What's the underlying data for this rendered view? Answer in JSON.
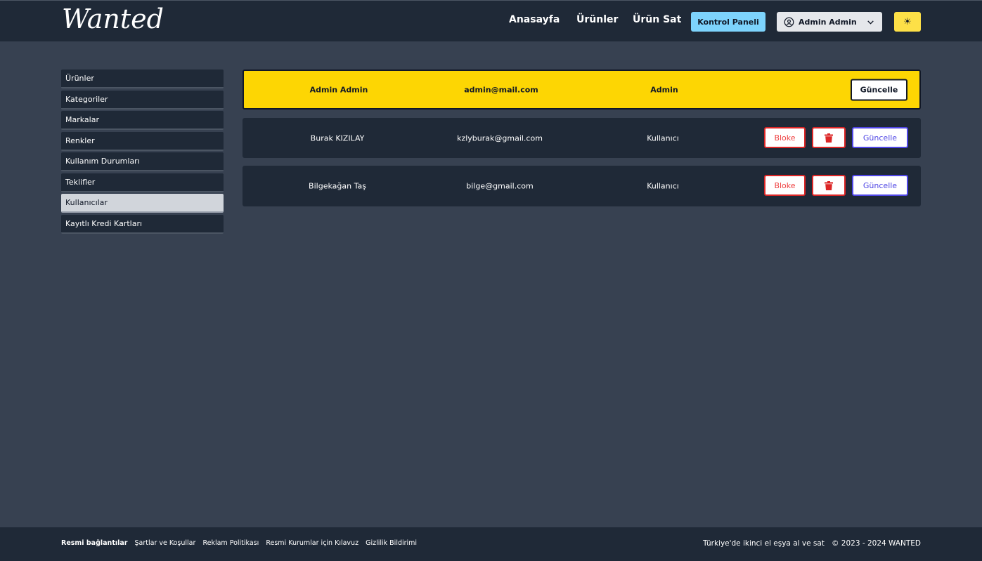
{
  "header": {
    "logo": "Wanted",
    "nav": [
      "Anasayfa",
      "Ürünler",
      "Ürün Sat"
    ],
    "panel_button": "Kontrol Paneli",
    "user_menu": "Admin Admin",
    "theme_icon": "sun-icon"
  },
  "sidebar": {
    "items": [
      {
        "label": "Ürünler"
      },
      {
        "label": "Kategoriler"
      },
      {
        "label": "Markalar"
      },
      {
        "label": "Renkler"
      },
      {
        "label": "Kullanım Durumları"
      },
      {
        "label": "Teklifler"
      },
      {
        "label": "Kullanıcılar",
        "active": true
      },
      {
        "label": "Kayıtlı Kredi Kartları"
      }
    ]
  },
  "users": {
    "admin": {
      "name": "Admin Admin",
      "email": "admin@mail.com",
      "role": "Admin",
      "update": "Güncelle"
    },
    "rows": [
      {
        "name": "Burak KIZILAY",
        "email": "kzlyburak@gmail.com",
        "role": "Kullanıcı",
        "block": "Bloke",
        "update": "Güncelle"
      },
      {
        "name": "Bilgekağan Taş",
        "email": "bilge@gmail.com",
        "role": "Kullanıcı",
        "block": "Bloke",
        "update": "Güncelle"
      }
    ]
  },
  "footer": {
    "links_title": "Resmi bağlantılar",
    "links": [
      "Şartlar ve Koşullar",
      "Reklam Politikası",
      "Resmi Kurumlar için Kılavuz",
      "Gizlilik Bildirimi"
    ],
    "tagline": "Türkiye'de ikinci el eşya al ve sat",
    "copyright": "© 2023 - 2024 WANTED"
  },
  "colors": {
    "header_bg": "#1f2937",
    "page_bg": "#374151",
    "admin_row": "#fdd603",
    "panel_button": "#7dd3fc",
    "danger": "#dc2626",
    "primary": "#4f46e5"
  }
}
